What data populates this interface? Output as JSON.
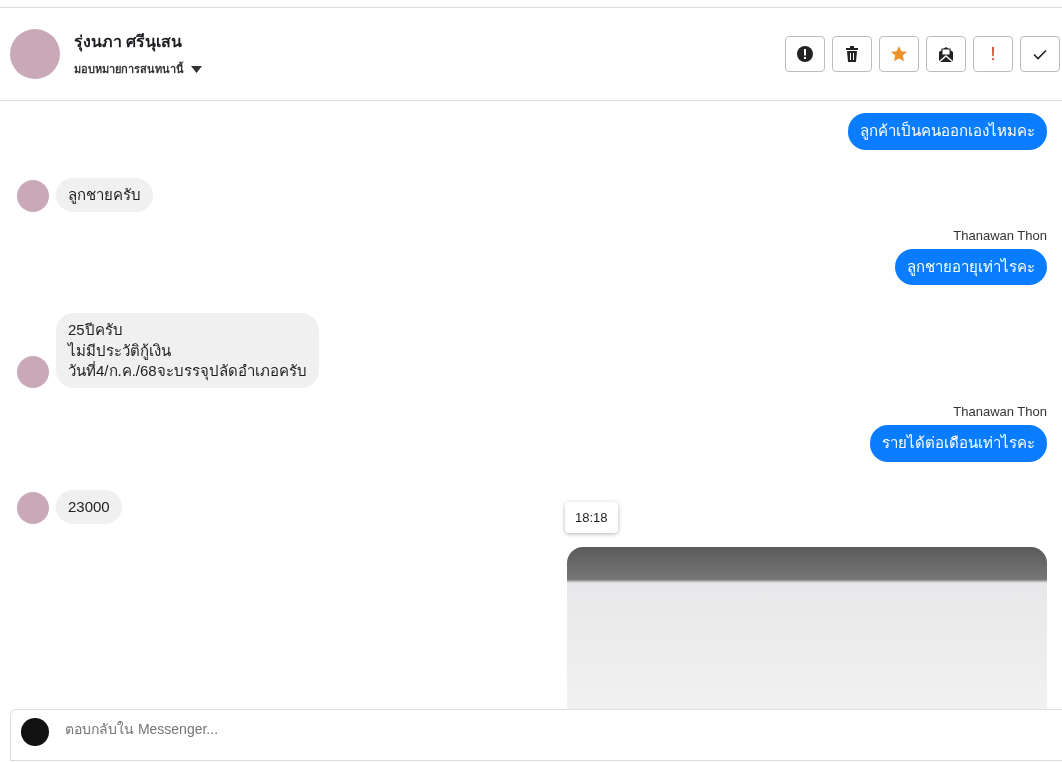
{
  "contact": {
    "name": "รุ่งนภา ศรีนุเสน",
    "assign_label": "มอบหมายการสนทนานี้"
  },
  "toolbar": [
    {
      "kind": "spam"
    },
    {
      "kind": "delete"
    },
    {
      "kind": "star"
    },
    {
      "kind": "unread"
    },
    {
      "kind": "important",
      "text": "!"
    },
    {
      "kind": "done"
    }
  ],
  "messages": [
    {
      "kind": "outgoing",
      "lines": [
        "ลูกค้าเป็นคนออกเองไหมคะ"
      ]
    },
    {
      "kind": "incoming",
      "lines": [
        "ลูกชายครับ"
      ]
    },
    {
      "kind": "outgoing",
      "sender": "Thanawan Thon",
      "lines": [
        "ลูกชายอายุเท่าไรคะ"
      ]
    },
    {
      "kind": "incoming",
      "lines": [
        "25ปีครับ",
        "ไม่มีประวัติกู้เงิน",
        "วันที่4/ก.ค./68จะบรรจุปลัดอำเภอครับ"
      ]
    },
    {
      "kind": "outgoing",
      "sender": "Thanawan Thon",
      "lines": [
        "รายได้ต่อเดือนเท่าไรคะ"
      ]
    },
    {
      "kind": "incoming",
      "lines": [
        "23000"
      ]
    },
    {
      "kind": "image",
      "time": "18:18"
    }
  ],
  "composer": {
    "placeholder": "ตอบกลับใน Messenger..."
  }
}
